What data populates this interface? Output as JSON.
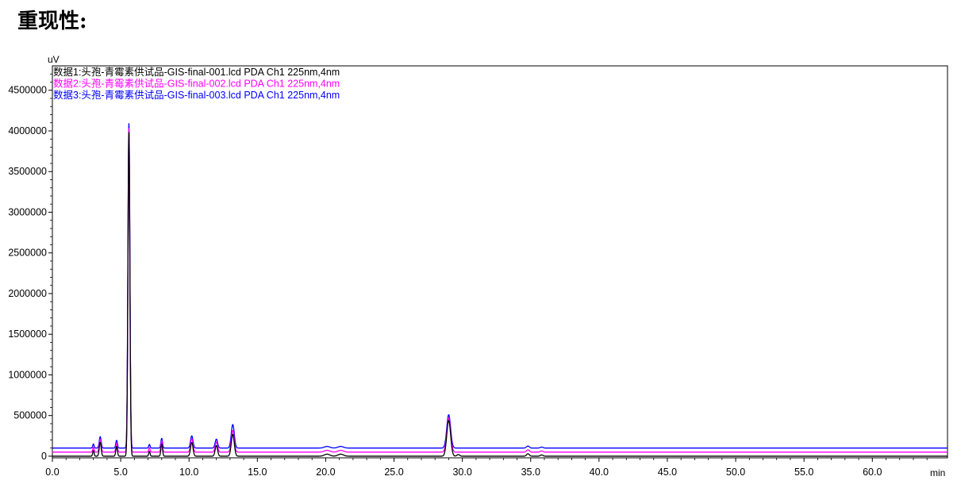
{
  "page": {
    "title": "重现性:"
  },
  "chart_data": {
    "type": "line",
    "xlabel": "min",
    "ylabel": "uV",
    "xlim": [
      0,
      65.5
    ],
    "ylim": [
      -20000,
      4800000
    ],
    "xticks": [
      "0.0",
      "5.0",
      "10.0",
      "15.0",
      "20.0",
      "25.0",
      "30.0",
      "35.0",
      "40.0",
      "45.0",
      "50.0",
      "55.0",
      "60.0"
    ],
    "yticks": [
      "0",
      "500000",
      "1000000",
      "1500000",
      "2000000",
      "2500000",
      "3000000",
      "3500000",
      "4000000",
      "4500000"
    ],
    "legend_position": "top-left",
    "series": [
      {
        "name": "数据1:头孢-青霉素供试品-GIS-final-001.lcd PDA Ch1 225nm,4nm",
        "color": "#000000",
        "baseline": 0,
        "peaks": [
          {
            "t": 3.0,
            "h": 70000,
            "w": 0.05
          },
          {
            "t": 3.5,
            "h": 170000,
            "w": 0.07
          },
          {
            "t": 4.7,
            "h": 120000,
            "w": 0.06
          },
          {
            "t": 5.6,
            "h": 3980000,
            "w": 0.07
          },
          {
            "t": 7.1,
            "h": 60000,
            "w": 0.05
          },
          {
            "t": 8.0,
            "h": 150000,
            "w": 0.06
          },
          {
            "t": 10.2,
            "h": 170000,
            "w": 0.09
          },
          {
            "t": 12.0,
            "h": 130000,
            "w": 0.09
          },
          {
            "t": 13.2,
            "h": 270000,
            "w": 0.11
          },
          {
            "t": 20.1,
            "h": 25000,
            "w": 0.2
          },
          {
            "t": 21.1,
            "h": 25000,
            "w": 0.2
          },
          {
            "t": 29.0,
            "h": 440000,
            "w": 0.14
          },
          {
            "t": 29.7,
            "h": 20000,
            "w": 0.1
          },
          {
            "t": 34.8,
            "h": 30000,
            "w": 0.1
          },
          {
            "t": 35.8,
            "h": 15000,
            "w": 0.1
          }
        ]
      },
      {
        "name": "数据2:头孢-青霉素供试品-GIS-final-002.lcd PDA Ch1 225nm,4nm",
        "color": "#ff00ff",
        "baseline": 50000,
        "peaks": [
          {
            "t": 3.0,
            "h": 60000,
            "w": 0.05
          },
          {
            "t": 3.5,
            "h": 160000,
            "w": 0.07
          },
          {
            "t": 4.7,
            "h": 110000,
            "w": 0.06
          },
          {
            "t": 5.6,
            "h": 3980000,
            "w": 0.07
          },
          {
            "t": 7.1,
            "h": 55000,
            "w": 0.05
          },
          {
            "t": 8.0,
            "h": 140000,
            "w": 0.06
          },
          {
            "t": 10.2,
            "h": 165000,
            "w": 0.09
          },
          {
            "t": 12.0,
            "h": 125000,
            "w": 0.09
          },
          {
            "t": 13.2,
            "h": 265000,
            "w": 0.11
          },
          {
            "t": 20.1,
            "h": 22000,
            "w": 0.2
          },
          {
            "t": 21.1,
            "h": 22000,
            "w": 0.2
          },
          {
            "t": 29.0,
            "h": 420000,
            "w": 0.14
          },
          {
            "t": 34.8,
            "h": 28000,
            "w": 0.1
          },
          {
            "t": 35.8,
            "h": 14000,
            "w": 0.1
          }
        ]
      },
      {
        "name": "数据3:头孢-青霉素供试品-GIS-final-003.lcd PDA Ch1 225nm,4nm",
        "color": "#0000ff",
        "baseline": 100000,
        "peaks": [
          {
            "t": 3.0,
            "h": 50000,
            "w": 0.05
          },
          {
            "t": 3.5,
            "h": 140000,
            "w": 0.07
          },
          {
            "t": 4.7,
            "h": 95000,
            "w": 0.06
          },
          {
            "t": 5.6,
            "h": 3990000,
            "w": 0.07
          },
          {
            "t": 7.1,
            "h": 45000,
            "w": 0.05
          },
          {
            "t": 8.0,
            "h": 120000,
            "w": 0.06
          },
          {
            "t": 10.2,
            "h": 150000,
            "w": 0.09
          },
          {
            "t": 12.0,
            "h": 110000,
            "w": 0.09
          },
          {
            "t": 13.2,
            "h": 290000,
            "w": 0.11
          },
          {
            "t": 20.1,
            "h": 20000,
            "w": 0.2
          },
          {
            "t": 21.1,
            "h": 20000,
            "w": 0.2
          },
          {
            "t": 29.0,
            "h": 410000,
            "w": 0.14
          },
          {
            "t": 34.8,
            "h": 25000,
            "w": 0.1
          },
          {
            "t": 35.8,
            "h": 12000,
            "w": 0.1
          }
        ]
      }
    ]
  }
}
